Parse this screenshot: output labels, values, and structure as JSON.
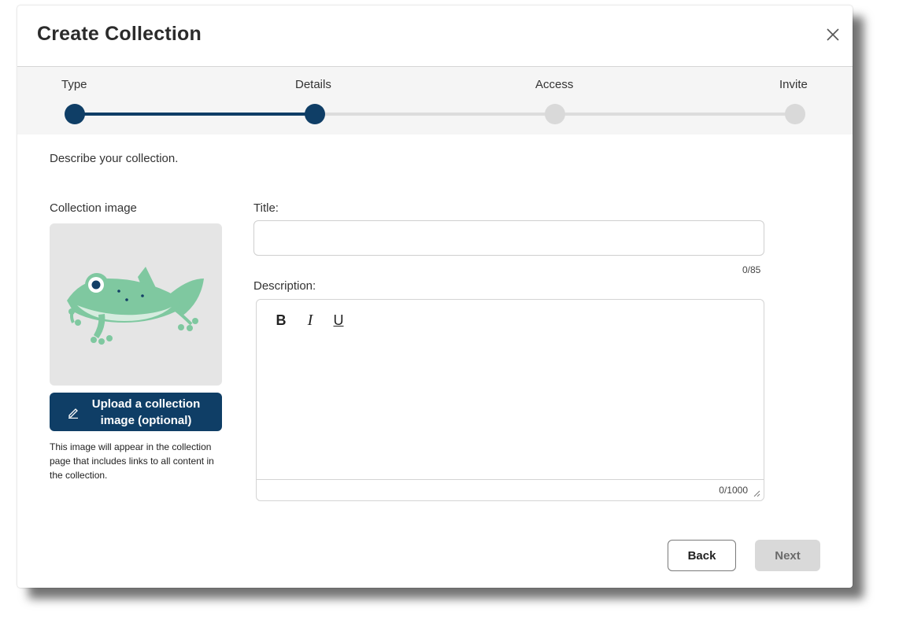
{
  "dialog": {
    "title": "Create Collection"
  },
  "stepper": {
    "steps": [
      {
        "label": "Type",
        "state": "complete"
      },
      {
        "label": "Details",
        "state": "current"
      },
      {
        "label": "Access",
        "state": "upcoming"
      },
      {
        "label": "Invite",
        "state": "upcoming"
      }
    ],
    "colors": {
      "active": "#0f3e66",
      "inactive": "#d9d9d9"
    }
  },
  "intro": "Describe your collection.",
  "image_section": {
    "label": "Collection image",
    "image_alt": "frog-illustration",
    "upload_label": "Upload a collection image (optional)",
    "help_text": "This image will appear in the collection page that includes links to all content in the collection."
  },
  "form": {
    "title_label": "Title:",
    "title_value": "",
    "title_counter": "0/85",
    "description_label": "Description:",
    "toolbar": {
      "bold": "B",
      "italic": "I",
      "underline": "U"
    },
    "description_value": "",
    "description_counter": "0/1000"
  },
  "actions": {
    "back": "Back",
    "next": "Next"
  },
  "colors": {
    "primary": "#0f3e66",
    "disabled": "#d9d9d9",
    "frog": "#7fc8a0"
  }
}
